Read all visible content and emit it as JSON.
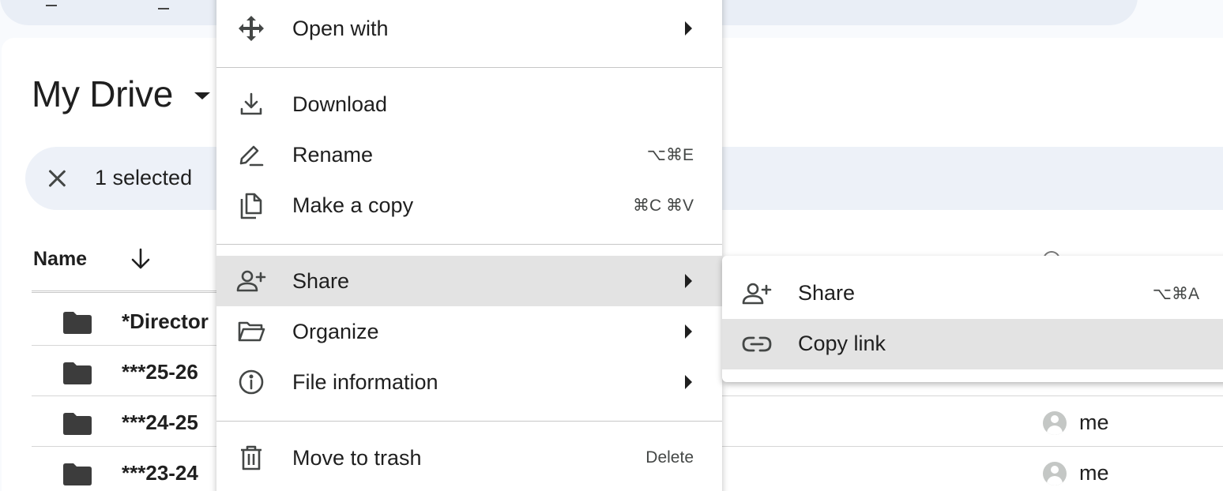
{
  "page": {
    "title": "My Drive",
    "selection_count": "1 selected",
    "column_name": "Name"
  },
  "rows": [
    {
      "name": "*Director",
      "owner": ""
    },
    {
      "name": "***25-26",
      "owner": ""
    },
    {
      "name": "***24-25",
      "owner": "me"
    },
    {
      "name": "***23-24",
      "owner": "me"
    }
  ],
  "context_menu": {
    "open_with": "Open with",
    "download": "Download",
    "rename": "Rename",
    "rename_shortcut": "⌥⌘E",
    "make_copy": "Make a copy",
    "make_copy_shortcut": "⌘C ⌘V",
    "share": "Share",
    "organize": "Organize",
    "file_information": "File information",
    "move_to_trash": "Move to trash",
    "move_to_trash_shortcut": "Delete"
  },
  "share_submenu": {
    "share": "Share",
    "share_shortcut": "⌥⌘A",
    "copy_link": "Copy link"
  },
  "colors": {
    "background": "#f8fafd",
    "selection_bar": "#edf1f8",
    "menu_highlight": "#e3e3e3",
    "icon": "#444746"
  }
}
